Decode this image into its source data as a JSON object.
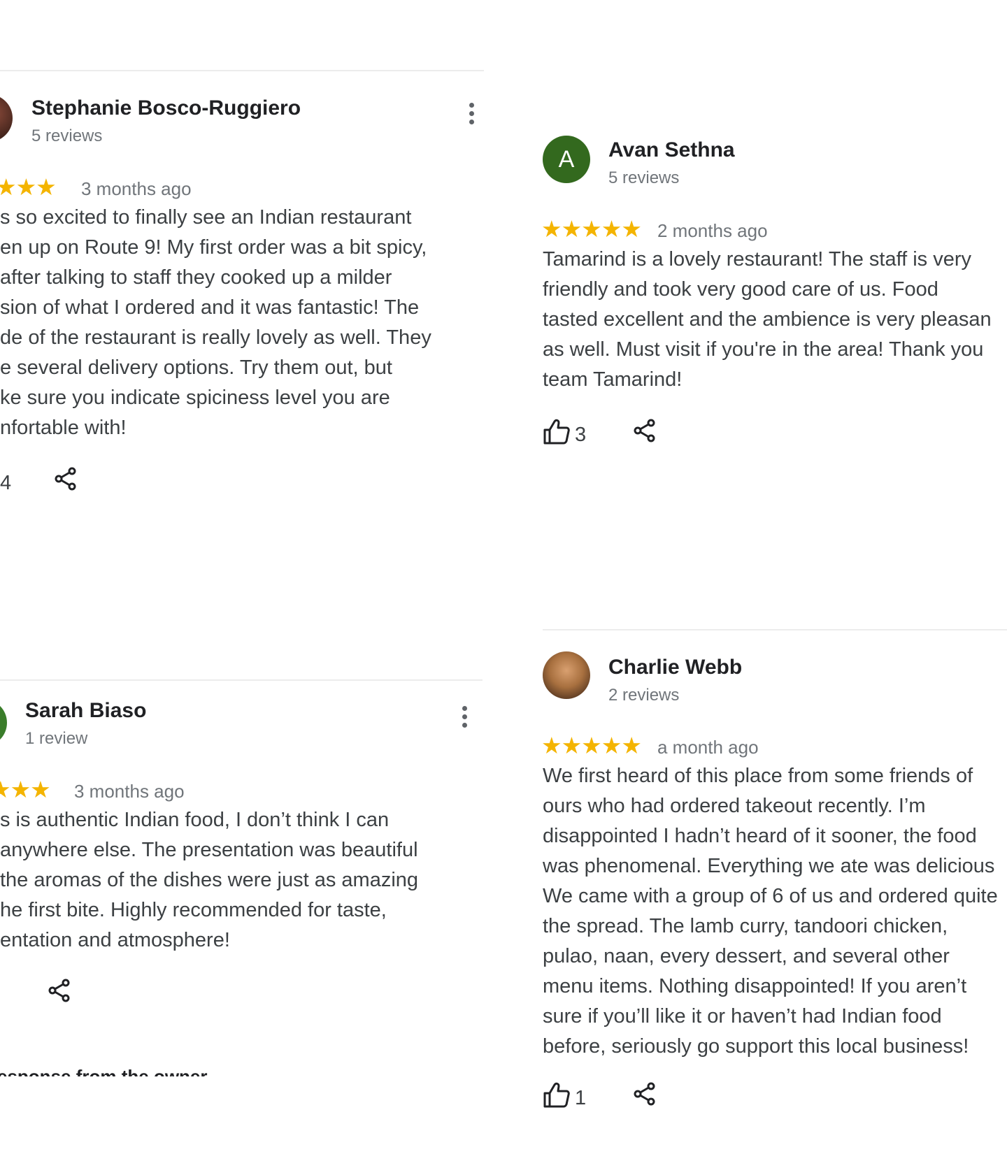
{
  "reviews": [
    {
      "name": "Stephanie Bosco-Ruggiero",
      "review_count": "5 reviews",
      "stars": "★★★",
      "date": "3 months ago",
      "text_lines": [
        "s so excited to finally see an Indian restaurant",
        "en up on Route 9! My first order was a bit spicy,",
        " after talking to staff they cooked up a milder",
        "sion of what I ordered and it was fantastic! The",
        "de of the restaurant is really lovely as well. They",
        "e several delivery options. Try them out, but",
        "ke sure you indicate spiciness level you are",
        "nfortable with!"
      ],
      "likes": "4",
      "icons": {
        "more": "more-vert-icon",
        "share": "share-icon"
      }
    },
    {
      "name": "Avan Sethna",
      "avatar_letter": "A",
      "review_count": "5 reviews",
      "stars": "★★★★★",
      "date": "2 months ago",
      "text_lines": [
        "Tamarind is a lovely restaurant! The staff is very",
        "friendly and took very good care of us. Food",
        "tasted excellent and the ambience is very pleasan",
        "as well. Must visit if you're in the area! Thank you",
        "team Tamarind!"
      ],
      "likes": "3",
      "icons": {
        "like": "thumbs-up-icon",
        "share": "share-icon"
      }
    },
    {
      "name": "Sarah Biaso",
      "review_count": "1 review",
      "stars": "★★★",
      "date": "3 months ago",
      "text_lines": [
        "s is authentic Indian food, I don’t think I can",
        "anywhere else. The presentation was beautiful",
        " the aromas of the dishes were just as amazing",
        "he first bite. Highly recommended for taste,",
        "entation and atmosphere!"
      ],
      "owner_response": "esponse from the owner",
      "icons": {
        "more": "more-vert-icon",
        "share": "share-icon"
      }
    },
    {
      "name": "Charlie Webb",
      "review_count": "2 reviews",
      "stars": "★★★★★",
      "date": "a month ago",
      "text_lines": [
        "We first heard of this place from some friends of",
        "ours who had ordered takeout recently. I’m",
        "disappointed I hadn’t heard of it sooner, the food",
        "was phenomenal. Everything we ate was delicious",
        "We came with a group of 6 of us and ordered quite",
        "the spread. The lamb curry, tandoori chicken,",
        "pulao, naan, every dessert, and several other",
        "menu items. Nothing disappointed! If you aren’t",
        "sure if you’ll like it or haven’t had Indian food",
        "before, seriously go support this local business!"
      ],
      "likes": "1",
      "icons": {
        "like": "thumbs-up-icon",
        "share": "share-icon"
      }
    }
  ],
  "colors": {
    "star": "#f4b400",
    "avatar_green": "#33691e",
    "muted": "#70757a",
    "text": "#3c4043"
  }
}
